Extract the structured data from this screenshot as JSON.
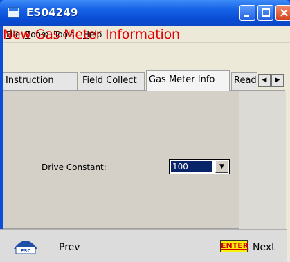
{
  "window": {
    "title": "ES04249",
    "controls": {
      "minimize": "minimize",
      "maximize": "maximize",
      "close": "×"
    }
  },
  "menubar": {
    "items": [
      {
        "key": "F",
        "rest": "ile"
      },
      {
        "key": "Z",
        "rest": "oom"
      },
      {
        "key": "T",
        "rest": "ools"
      },
      {
        "key": "H",
        "rest": "elp"
      }
    ]
  },
  "form": {
    "title": "New Gas Meter Information",
    "title_color": "#e60000"
  },
  "tabs": [
    {
      "label": "Instruction",
      "active": false
    },
    {
      "label": "Field Collect",
      "active": false
    },
    {
      "label": "Gas Meter Info",
      "active": true
    },
    {
      "label": "Readi",
      "active": false
    }
  ],
  "tab_scroll": {
    "left": "◀",
    "right": "▶"
  },
  "fields": {
    "drive_constant": {
      "label": "Drive Constant:",
      "value": "100",
      "arrow": "▼"
    }
  },
  "navbar": {
    "esc_label": "ESC",
    "prev_label": "Prev",
    "enter_label": "ENTER",
    "next_label": "Next"
  },
  "colors": {
    "titlebar_blue": "#0a4ed6",
    "enter_yellow": "#f6f20a",
    "selection_navy": "#0a246a"
  }
}
